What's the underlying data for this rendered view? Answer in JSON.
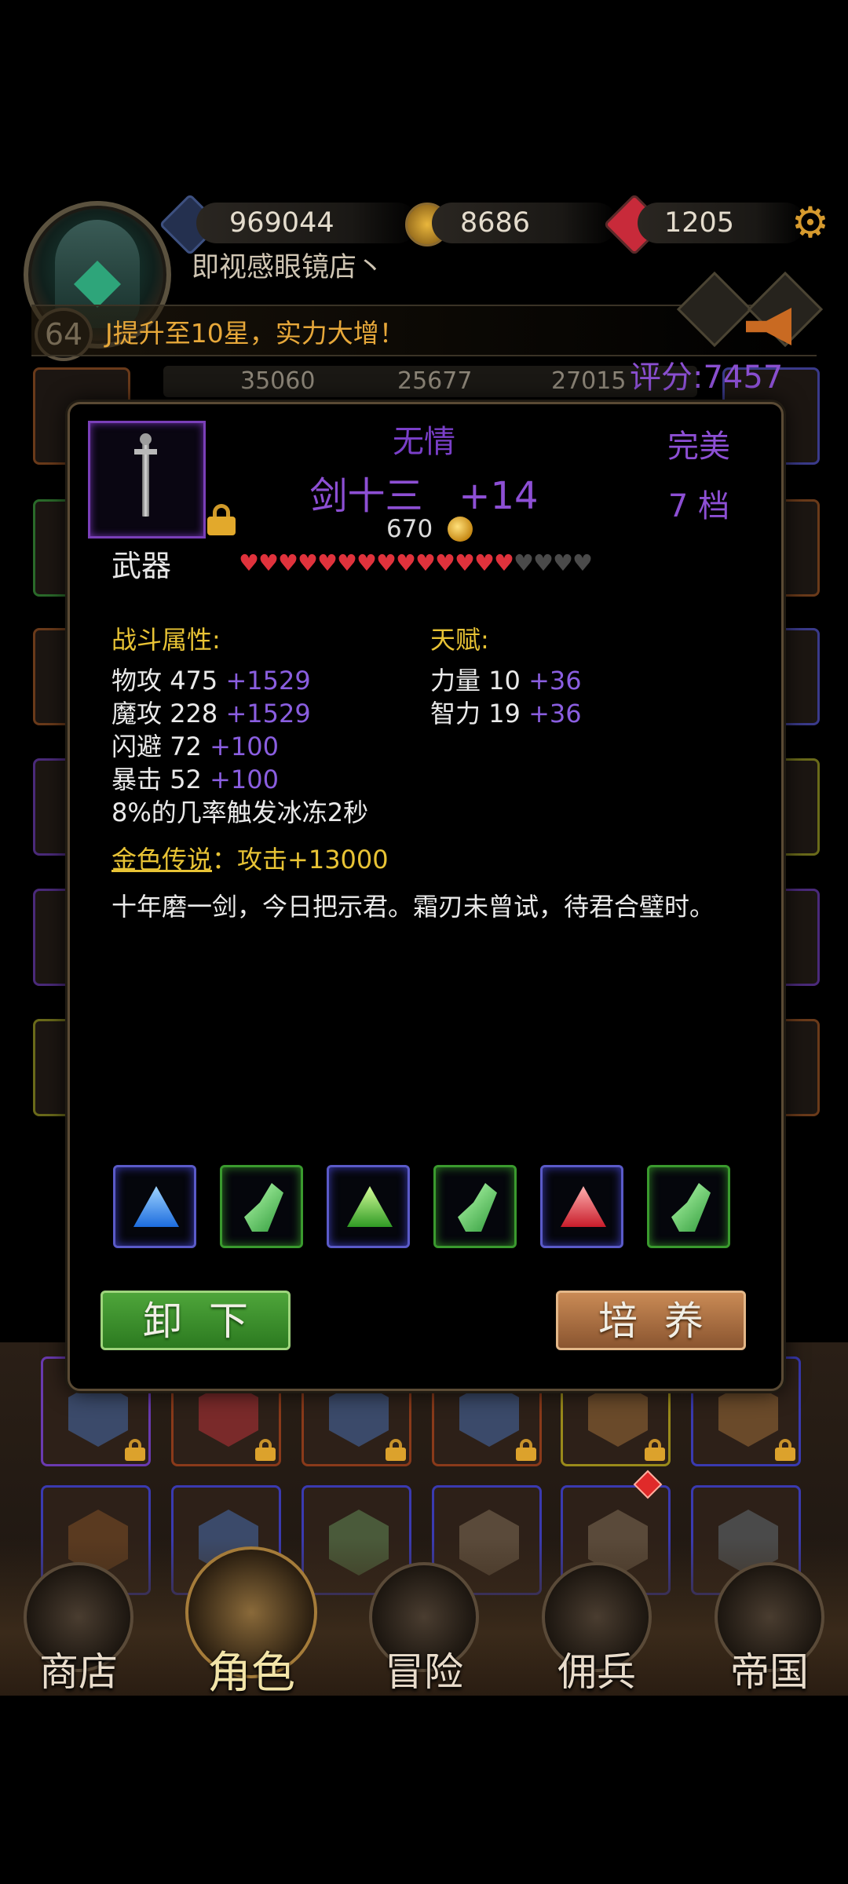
{
  "hud": {
    "player_name": "即视感眼镜店丶",
    "level": "64",
    "diamonds": "969044",
    "gold": "8686",
    "gems": "1205",
    "marquee": "J提升至10星，实力大增！",
    "score": "评分:7457",
    "bg_stats": [
      "35060",
      "25677",
      "27015"
    ]
  },
  "item": {
    "prefix": "无情",
    "name": "剑十三",
    "enhance": "+14",
    "price": "670",
    "quality": "完美",
    "grade": "7 档",
    "slot_type": "武器",
    "stars_filled": 14,
    "stars_total": 18
  },
  "combat": {
    "title": "战斗属性:",
    "stats": [
      {
        "name": "物攻",
        "base": "475",
        "bonus": "+1529"
      },
      {
        "name": "魔攻",
        "base": "228",
        "bonus": "+1529"
      },
      {
        "name": "闪避",
        "base": "72",
        "bonus": "+100"
      },
      {
        "name": "暴击",
        "base": "52",
        "bonus": "+100"
      }
    ],
    "effect": "8%的几率触发冰冻2秒"
  },
  "talent": {
    "title": "天赋:",
    "stats": [
      {
        "name": "力量",
        "base": "10",
        "bonus": "+36"
      },
      {
        "name": "智力",
        "base": "19",
        "bonus": "+36"
      }
    ]
  },
  "legend": {
    "link": "金色传说",
    "text": "：攻击+13000"
  },
  "flavor": "十年磨一剑，今日把示君。霜刃未曾试，待君合璧时。",
  "gems": [
    {
      "frame": "blue",
      "gem": "blue-triangle-gem-icon",
      "color": "#3a8cff"
    },
    {
      "frame": "green",
      "gem": "green-leaf-gem-icon",
      "color": "#5fd35a"
    },
    {
      "frame": "blue",
      "gem": "green-triangle-gem-icon",
      "color": "#4cc43c"
    },
    {
      "frame": "green",
      "gem": "green-leaf-gem-icon",
      "color": "#5fd35a"
    },
    {
      "frame": "blue",
      "gem": "red-triangle-gem-icon",
      "color": "#e0303a"
    },
    {
      "frame": "green",
      "gem": "green-leaf-gem-icon",
      "color": "#5fd35a"
    }
  ],
  "buttons": {
    "unequip": "卸下",
    "train": "培养"
  },
  "nav": [
    {
      "label": "商店",
      "icon": "castle-icon"
    },
    {
      "label": "角色",
      "icon": "hooded-figure-icon",
      "active": true
    },
    {
      "label": "冒险",
      "icon": "crossed-swords-icon"
    },
    {
      "label": "佣兵",
      "icon": "mercenary-card-icon"
    },
    {
      "label": "帝国",
      "icon": "crown-icon"
    }
  ]
}
